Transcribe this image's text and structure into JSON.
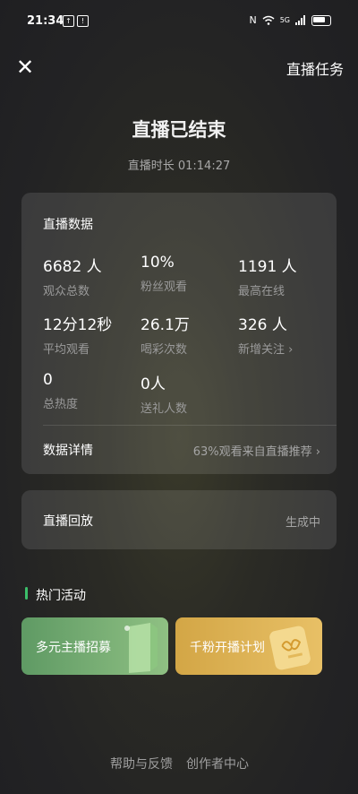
{
  "status_bar": {
    "time": "21:34",
    "icon1": "↑",
    "icon2": "!",
    "network": "5G"
  },
  "header": {
    "close_icon": "✕",
    "task_label": "直播任务"
  },
  "summary": {
    "title": "直播已结束",
    "duration": "直播时长 01:14:27"
  },
  "data_card": {
    "title": "直播数据",
    "stats": [
      {
        "value": "6682 人",
        "label": "观众总数"
      },
      {
        "value": "10%",
        "label": "粉丝观看"
      },
      {
        "value": "1191 人",
        "label": "最高在线"
      },
      {
        "value": "12分12秒",
        "label": "平均观看"
      },
      {
        "value": "26.1万",
        "label": "喝彩次数"
      },
      {
        "value": "326 人",
        "label": "新增关注"
      },
      {
        "value": "0",
        "label": "总热度"
      },
      {
        "value": "0人",
        "label": "送礼人数"
      }
    ],
    "new_follow_chevron": "›",
    "detail_label": "数据详情",
    "detail_value": "63%观看来自直播推荐 ›"
  },
  "replay": {
    "label": "直播回放",
    "status": "生成中"
  },
  "hot_activities": {
    "title": "热门活动",
    "banners": [
      {
        "label": "多元主播招募",
        "color": "#6ea86e"
      },
      {
        "label": "千粉开播计划",
        "color": "#dcb152"
      }
    ]
  },
  "footer": {
    "help": "帮助与反馈",
    "creator": "创作者中心"
  }
}
